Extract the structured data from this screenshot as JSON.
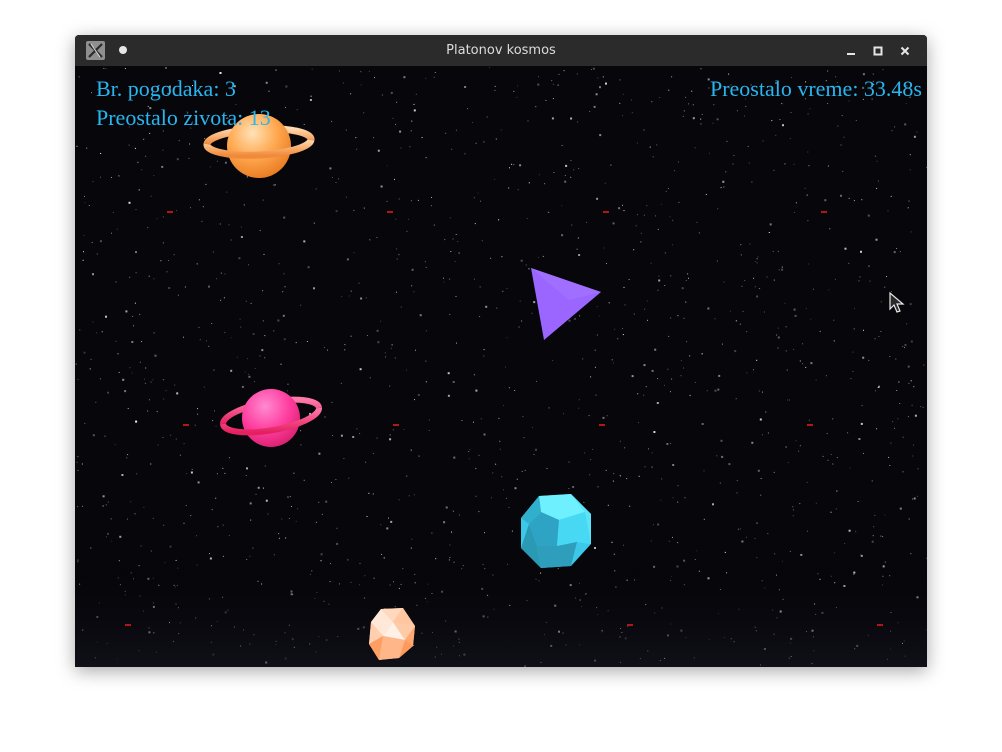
{
  "window": {
    "title": "Platonov kosmos",
    "icon": "x-app-icon",
    "controls": [
      "minimize-icon",
      "maximize-icon",
      "close-icon"
    ]
  },
  "hud": {
    "hits_text": "Br. pogodaka: 3",
    "lives_text": "Preostalo zivota: 13",
    "time_text": "Preostalo vreme: 33.48s",
    "color": "#27b6f0"
  },
  "scene": {
    "background": "starfield",
    "objects": [
      {
        "name": "orange-ringed-planet",
        "color": "#ffa040"
      },
      {
        "name": "purple-tetrahedron",
        "color": "#9966ff"
      },
      {
        "name": "pink-ringed-planet",
        "color": "#ff4488"
      },
      {
        "name": "cyan-dodecahedron",
        "color": "#44e0ff"
      },
      {
        "name": "peach-icosahedron",
        "color": "#ffb888"
      }
    ]
  }
}
